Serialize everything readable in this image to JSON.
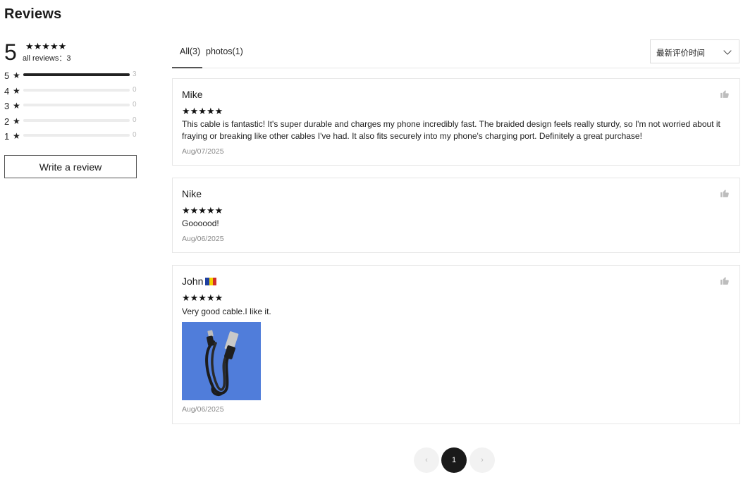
{
  "title": "Reviews",
  "summary": {
    "score": "5",
    "stars": "★★★★★",
    "all_reviews": "all reviews：3",
    "distribution": [
      {
        "stars": "5",
        "count": "3",
        "fraction": 1.0
      },
      {
        "stars": "4",
        "count": "0",
        "fraction": 0
      },
      {
        "stars": "3",
        "count": "0",
        "fraction": 0
      },
      {
        "stars": "2",
        "count": "0",
        "fraction": 0
      },
      {
        "stars": "1",
        "count": "0",
        "fraction": 0
      }
    ],
    "star_glyph": "★",
    "write_review": "Write a review"
  },
  "tabs": [
    {
      "label": "All(3)",
      "active": true
    },
    {
      "label": "photos(1)",
      "active": false
    }
  ],
  "sort": {
    "selected": "最新评价时间"
  },
  "reviews": [
    {
      "author": "Mike",
      "stars": "★★★★★",
      "text": "This cable is fantastic! It's super durable and charges my phone incredibly fast. The braided design feels really sturdy, so I'm not worried about it fraying or breaking like other cables I've had. It also fits securely into my phone's charging port. Definitely a great purchase!",
      "date": "Aug/07/2025"
    },
    {
      "author": "Nike",
      "stars": "★★★★★",
      "text": "Goooood!",
      "date": "Aug/06/2025"
    },
    {
      "author": "John",
      "flag": "romania-flag-icon",
      "stars": "★★★★★",
      "text": "Very good cable.I like it.",
      "date": "Aug/06/2025",
      "has_photo": true
    }
  ],
  "pagination": {
    "prev": "‹",
    "current": "1",
    "next": "›"
  },
  "colors": {
    "accent": "#1a1a1a",
    "photo_bg": "#4a78d8",
    "flag": [
      "#1e3fa0",
      "#f5d000",
      "#d22f27"
    ]
  }
}
